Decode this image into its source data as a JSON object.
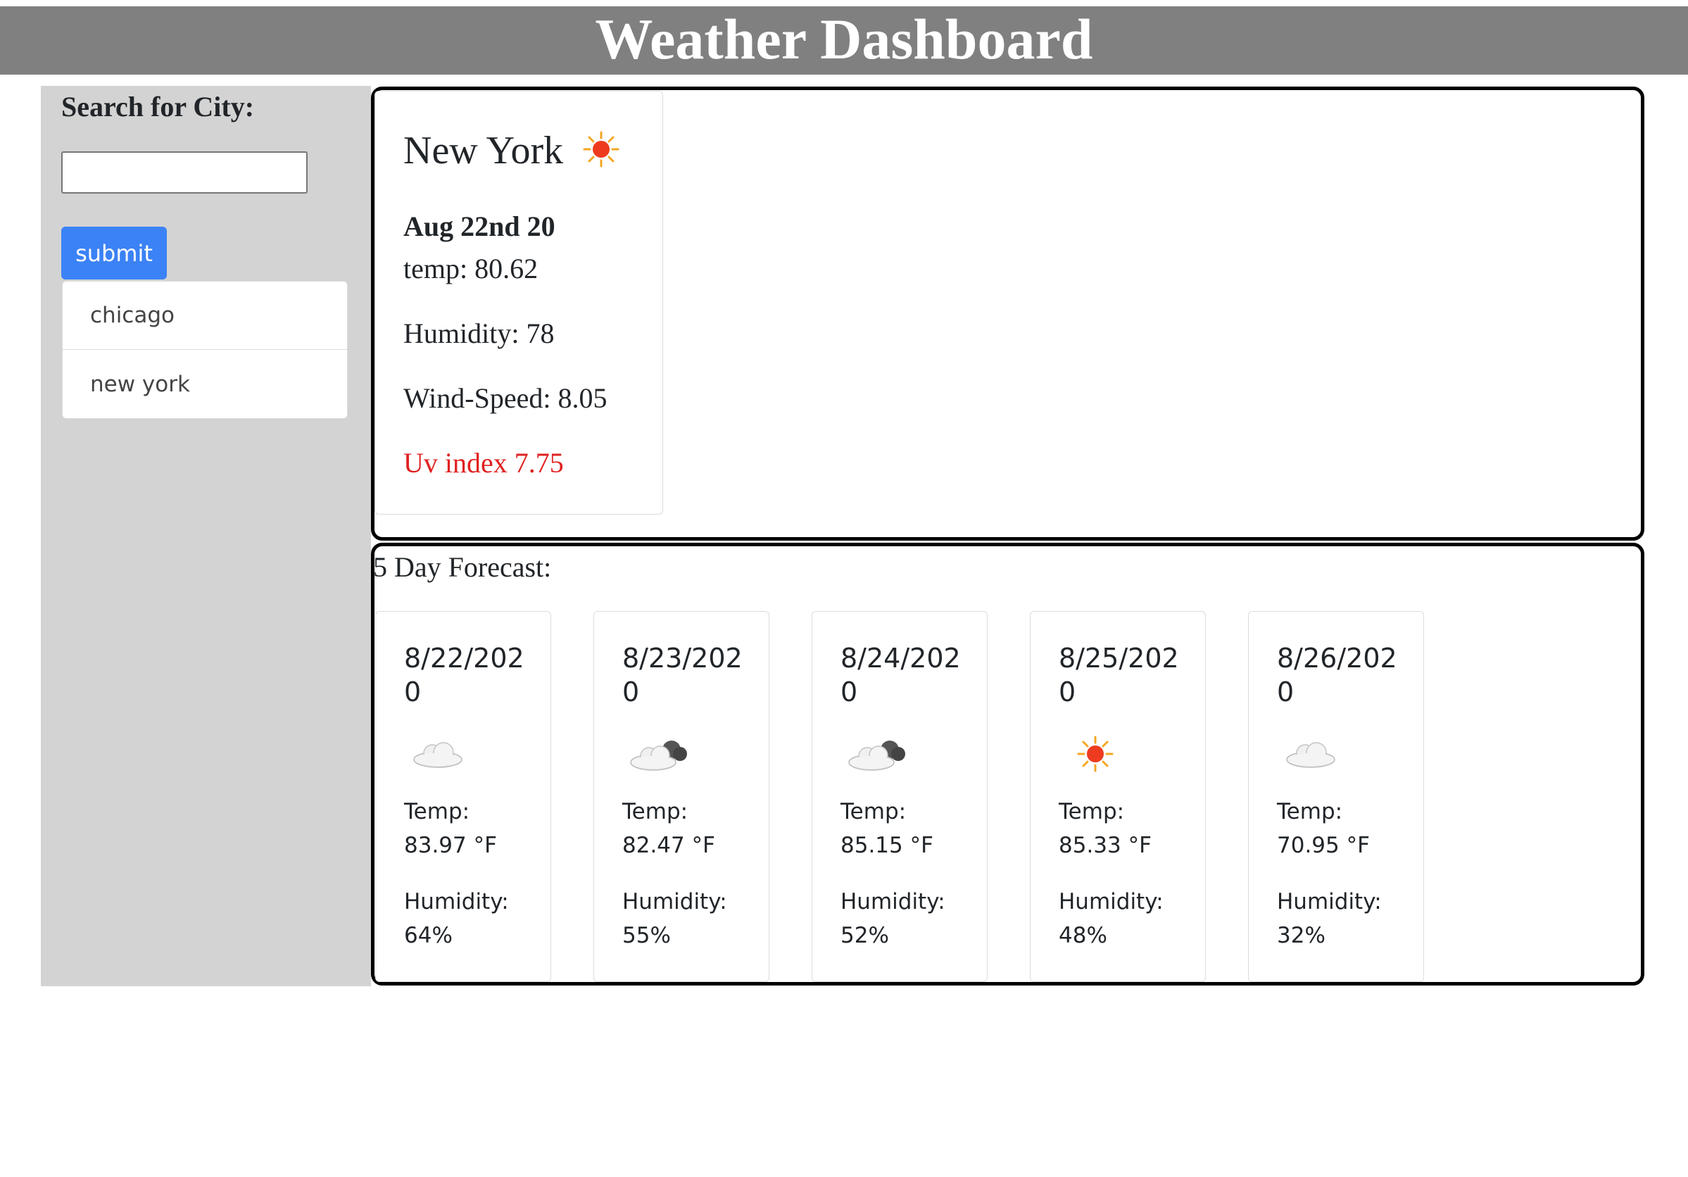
{
  "header": {
    "title": "Weather Dashboard"
  },
  "sidebar": {
    "label": "Search for City:",
    "search": {
      "value": "",
      "placeholder": ""
    },
    "submit_label": "submit",
    "history": [
      "chicago",
      "new york"
    ]
  },
  "current": {
    "city": "New York",
    "icon": "sun-icon",
    "date": "Aug 22nd 20",
    "temp": "temp: 80.62",
    "humidity": "Humidity: 78",
    "wind": "Wind-Speed: 8.05",
    "uv": "Uv index 7.75",
    "uv_color": "#e02020"
  },
  "forecast": {
    "title": "5 Day Forecast:",
    "temp_label": "Temp:",
    "humidity_label": "Humidity:",
    "days": [
      {
        "date": "8/22/2020",
        "icon": "cloud-icon",
        "temp": "83.97 °F",
        "humidity": "64%"
      },
      {
        "date": "8/23/2020",
        "icon": "cloud-dark-icon",
        "temp": "82.47 °F",
        "humidity": "55%"
      },
      {
        "date": "8/24/2020",
        "icon": "cloud-dark-icon",
        "temp": "85.15 °F",
        "humidity": "52%"
      },
      {
        "date": "8/25/2020",
        "icon": "sun-icon",
        "temp": "85.33 °F",
        "humidity": "48%"
      },
      {
        "date": "8/26/2020",
        "icon": "cloud-icon",
        "temp": "70.95 °F",
        "humidity": "32%"
      }
    ]
  }
}
